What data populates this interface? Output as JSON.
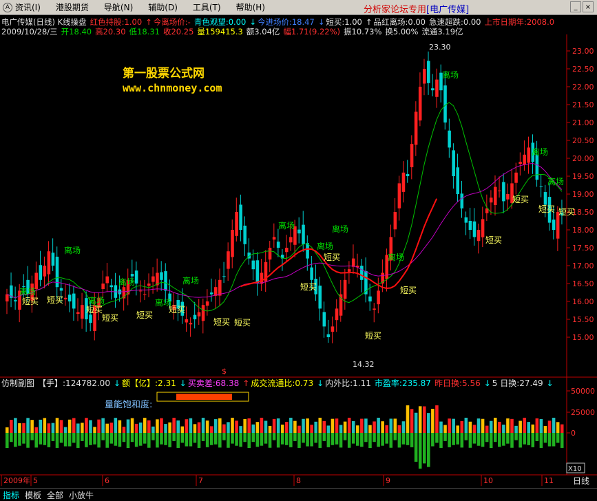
{
  "menu": {
    "items": [
      "资讯(I)",
      "港股期货",
      "导航(N)",
      "辅助(D)",
      "工具(T)",
      "帮助(H)"
    ],
    "sys": "A",
    "brand": "分析家论坛专用",
    "brand_tag": "[电广传媒]",
    "min": "_",
    "close": "×"
  },
  "info_line1": [
    {
      "t": "电广传媒(日线) K线操盘",
      "c": "w"
    },
    {
      "t": "红色持股:1.00",
      "c": "r"
    },
    {
      "t": "↑",
      "c": "r"
    },
    {
      "t": "今离场价:-",
      "c": "r"
    },
    {
      "t": "青色观望:0.00",
      "c": "c"
    },
    {
      "t": "↓",
      "c": "c"
    },
    {
      "t": "今进场价:18.47",
      "c": "b"
    },
    {
      "t": "↓",
      "c": "b"
    },
    {
      "t": "短买:1.00",
      "c": "w"
    },
    {
      "t": "↑",
      "c": "w"
    },
    {
      "t": "品红离场:0.00",
      "c": "w"
    },
    {
      "t": "急速超跌:0.00",
      "c": "w"
    },
    {
      "t": "上市日期年:2008.0",
      "c": "r"
    }
  ],
  "info_line2": [
    {
      "t": "2009/10/28/三",
      "c": "w"
    },
    {
      "t": "开18.40",
      "c": "g"
    },
    {
      "t": "高20.30",
      "c": "r"
    },
    {
      "t": "低18.31",
      "c": "g"
    },
    {
      "t": "收20.25",
      "c": "r"
    },
    {
      "t": "量159415.3",
      "c": "y"
    },
    {
      "t": "额3.04亿",
      "c": "w"
    },
    {
      "t": "幅1.71(9.22%)",
      "c": "r"
    },
    {
      "t": "振10.73%",
      "c": "w"
    },
    {
      "t": "换5.00%",
      "c": "w"
    },
    {
      "t": "流通3.19亿",
      "c": "w"
    }
  ],
  "watermark": {
    "line1": "第一股票公式网",
    "line2": "www.chnmoney.com"
  },
  "sub_info": [
    {
      "t": "仿制副图",
      "c": "w"
    },
    {
      "t": "【手】:124782.00",
      "c": "w"
    },
    {
      "t": "↓",
      "c": "c"
    },
    {
      "t": "额【亿】:2.31",
      "c": "y"
    },
    {
      "t": "↓",
      "c": "c"
    },
    {
      "t": "买卖差:68.38",
      "c": "m"
    },
    {
      "t": "↑",
      "c": "r"
    },
    {
      "t": "成交流通比:0.73",
      "c": "y"
    },
    {
      "t": "↓",
      "c": "c"
    },
    {
      "t": "内外比:1.11",
      "c": "w"
    },
    {
      "t": "市盈率:235.87",
      "c": "c"
    },
    {
      "t": "昨日换:5.56",
      "c": "r"
    },
    {
      "t": "↓",
      "c": "c"
    },
    {
      "t": "5 日换:27.49",
      "c": "w"
    },
    {
      "t": "↓",
      "c": "c"
    }
  ],
  "sub_label": "量能饱和度:",
  "colors": {
    "up": "#ff2020",
    "down": "#00d0d0",
    "ma1": "#00c000",
    "ma2": "#c000c0",
    "axis": "#c00000"
  },
  "price_axis": {
    "ticks": [
      "15.00",
      "15.50",
      "16.00",
      "16.50",
      "17.00",
      "17.50",
      "18.00",
      "18.50",
      "19.00",
      "19.50",
      "20.00",
      "20.50",
      "21.00",
      "21.50",
      "22.00",
      "22.50",
      "23.00"
    ]
  },
  "vol_axis": {
    "ticks": [
      "50000",
      "25000",
      "0"
    ],
    "unit": "X10"
  },
  "date_axis": {
    "labels": [
      "2009年",
      "5",
      "6",
      "7",
      "8",
      "9",
      "10",
      "11"
    ],
    "right": "日线"
  },
  "annotations": {
    "high": "23.30",
    "low": "14.32",
    "exit": "离场",
    "buy": "短买",
    "trigger": "$"
  },
  "bottom_tabs": [
    "指标",
    "模板",
    "全部",
    "小放牛"
  ]
}
